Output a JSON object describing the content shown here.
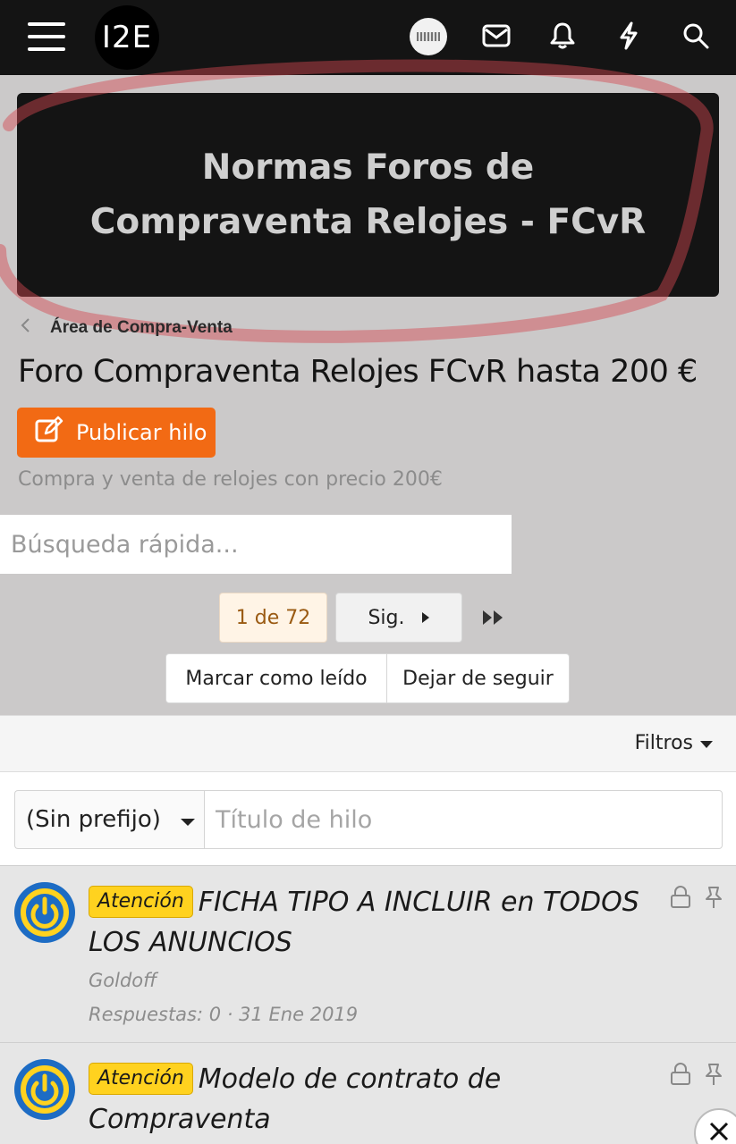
{
  "header": {
    "logo_text": "I2E",
    "icons": [
      "menu-icon",
      "avatar",
      "mail-icon",
      "bell-icon",
      "bolt-icon",
      "search-icon"
    ]
  },
  "banner": {
    "title": "Normas Foros de Compraventa Relojes - FCvR"
  },
  "breadcrumb": {
    "label": "Área de Compra-Venta"
  },
  "forum": {
    "title": "Foro Compraventa Relojes FCvR hasta 200 €",
    "publish_label": "Publicar hilo",
    "description": "Compra y venta de relojes con precio 200€"
  },
  "quick_search": {
    "placeholder": "Búsqueda rápida..."
  },
  "pagination": {
    "current": "1 de 72",
    "next_label": "Sig."
  },
  "actions": {
    "mark_read": "Marcar como leído",
    "unfollow": "Dejar de seguir"
  },
  "filter_bar": {
    "label": "Filtros"
  },
  "new_thread": {
    "prefix": "(Sin prefijo)",
    "title_placeholder": "Título de hilo"
  },
  "threads": [
    {
      "badge": "Atención",
      "title": "FICHA TIPO A INCLUIR en TODOS LOS ANUNCIOS",
      "author": "Goldoff",
      "meta": "Respuestas: 0 · 31 Ene 2019"
    },
    {
      "badge": "Atención",
      "title": "Modelo de contrato de Compraventa"
    }
  ],
  "colors": {
    "topbar": "#141414",
    "accent": "#f26a14",
    "badge": "#ffd21f",
    "avatar_ring": "#1d6cc4"
  }
}
